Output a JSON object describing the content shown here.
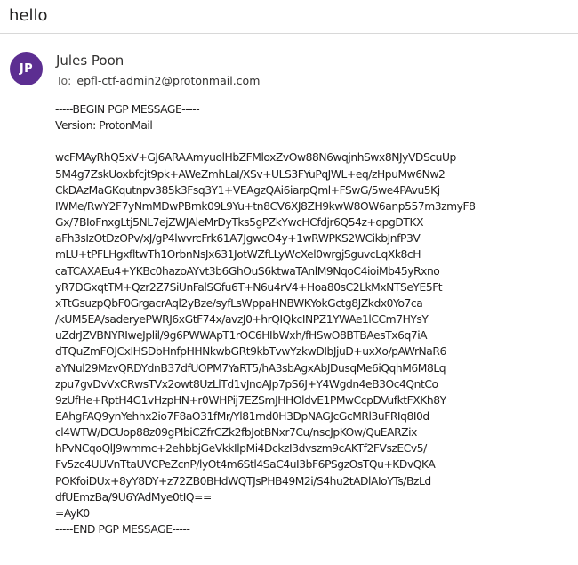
{
  "message": {
    "subject": "hello",
    "sender": {
      "initials": "JP",
      "name": "Jules Poon",
      "avatar_color": "#5c2e91"
    },
    "recipient": {
      "label": "To:",
      "address": "epfl-ctf-admin2@protonmail.com"
    },
    "body": "-----BEGIN PGP MESSAGE-----\nVersion: ProtonMail\n\nwcFMAyRhQ5xV+GJ6ARAAmyuolHbZFMloxZvOw88N6wqjnhSwx8NJyVDScuUp\n5M4g7ZskUoxbfcjt9pk+AWeZmhLaI/XSv+ULS3FYuPqJWL+eq/zHpuMw6Nw2\nCkDAzMaGKqutnpv385k3Fsq3Y1+VEAgzQAi6iarpQml+FSwG/5we4PAvu5Kj\nIWMe/RwY2F7yNmMDwPBmk09L9Yu+tn8CV6XJ8ZH9kwW8OW6anp557m3zmyF8\nGx/7BIoFnxgLtj5NL7ejZWJAleMrDyTks5gPZkYwcHCfdjr6Q54z+qpgDTKX\naFh3sIzOtDzOPv/xJ/gP4lwvrcFrk61A7JgwcO4y+1wRWPKS2WCikbJnfP3V\nmLU+tPFLHgxfltwTh1OrbnNsJx631JotWZfLLyWcXel0wrgjSguvcLqXk8cH\ncaTCAXAEu4+YKBc0hazoAYvt3b6GhOuS6ktwaTAnlM9NqoC4ioiMb45yRxno\nyR7DGxqtTM+Qzr2Z7SiUnFalSGfu6T+N6u4rV4+Hoa80sC2LkMxNTSeYE5Ft\nxTtGsuzpQbF0GrgacrAql2yBze/syfLsWppaHNBWKYokGctg8JZkdx0Yo7ca\n/kUM5EA/saderyePWRJ6xGtF74x/avzJ0+hrQIQkcINPZ1YWAe1lCCm7HYsY\nuZdrJZVBNYRIweJplil/9g6PWWApT1rOC6HIbWxh/fHSwO8BTBAesTx6q7iA\ndTQuZmFOJCxIHSDbHnfpHHNkwbGRt9kbTvwYzkwDIbJjuD+uxXo/pAWrNaR6\naYNul29MzvQRDYdnB37dfUOPM7YaRT5/hA3sbAgxAbJDusqMe6iQqhM6M8Lq\nzpu7gvDvVxCRwsTVx2owt8UzLlTd1vJnoAJp7pS6J+Y4Wgdn4eB3Oc4QntCo\n9zUfHe+RptH4G1vHzpHN+r0WHPij7EZSmJHHOldvE1PMwCcpDVufktFXKh8Y\nEAhgFAQ9ynYehhx2io7F8aO31fMr/Yl81md0H3DpNAGJcGcMRl3uFRIq8I0d\ncl4WTW/DCUop88z09gPIbiCZfrCZk2fbJotBNxr7Cu/nscJpKOw/QuEARZix\nhPvNCqoQlJ9wmmc+2ehbbjGeVkkIlpMi4DckzI3dvszm9cAKTf2FVszECv5/\nFv5zc4UUVnTtaUVCPeZcnP/lyOt4m6Stl4SaC4uI3bF6PSgzOsTQu+KDvQKA\nPOKfoiDUx+8yY8DY+z72ZB0BHdWQTJsPHB49M2i/S4hu2tADlAIoYTs/BzLd\ndfUEmzBa/9U6YAdMye0tIQ==\n=AyK0\n-----END PGP MESSAGE-----"
  }
}
